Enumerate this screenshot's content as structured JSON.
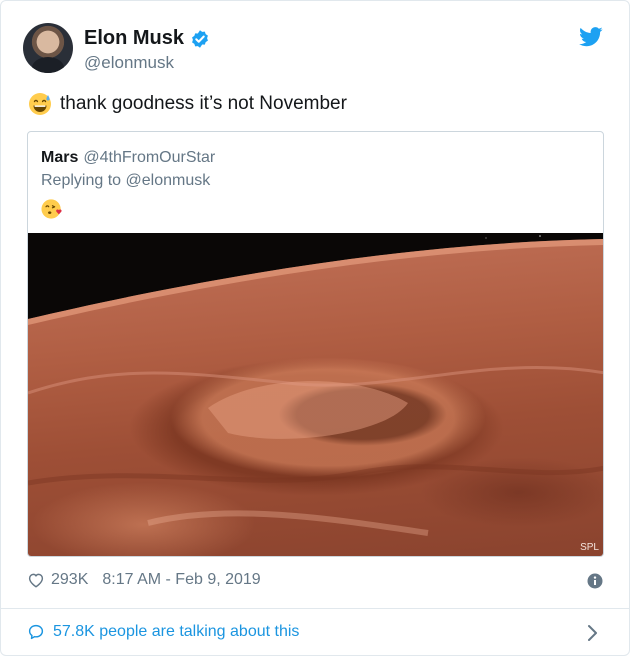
{
  "author": {
    "name": "Elon Musk",
    "handle": "@elonmusk",
    "verified": true
  },
  "tweet": {
    "emoji": "grinning-face-with-sweat",
    "text": "thank goodness it’s not November"
  },
  "quoted_tweet": {
    "name": "Mars",
    "handle": "@4thFromOurStar",
    "replying_to": "Replying to @elonmusk",
    "emoji": "face-blowing-a-kiss",
    "image_credit": "SPL"
  },
  "footer": {
    "likes": "293K",
    "timestamp": "8:17 AM - Feb 9, 2019",
    "talking": "57.8K people are talking about this"
  },
  "colors": {
    "twitter_blue": "#1da1f2",
    "link_blue": "#1b95e0",
    "muted": "#657786",
    "border": "#e1e8ed"
  }
}
